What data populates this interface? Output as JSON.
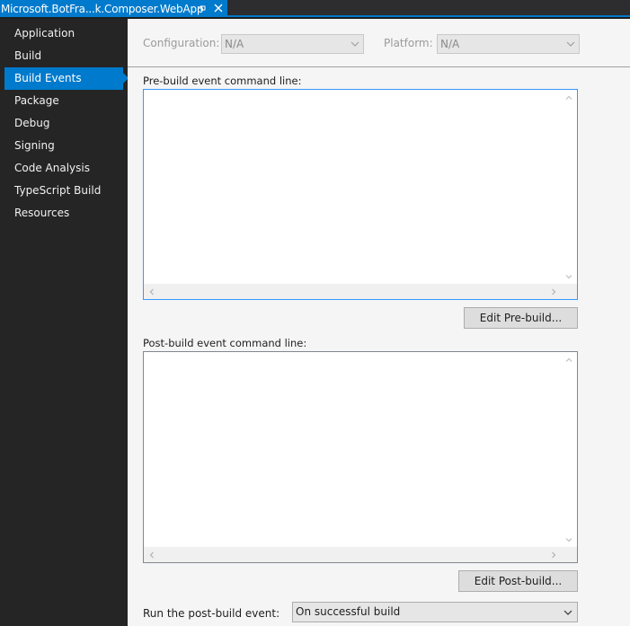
{
  "tab": {
    "title": "Microsoft.BotFra...k.Composer.WebApp",
    "pin_icon": "pin-icon",
    "close_icon": "close-icon"
  },
  "sidebar": {
    "items": [
      {
        "label": "Application",
        "selected": false
      },
      {
        "label": "Build",
        "selected": false
      },
      {
        "label": "Build Events",
        "selected": true
      },
      {
        "label": "Package",
        "selected": false
      },
      {
        "label": "Debug",
        "selected": false
      },
      {
        "label": "Signing",
        "selected": false
      },
      {
        "label": "Code Analysis",
        "selected": false
      },
      {
        "label": "TypeScript Build",
        "selected": false
      },
      {
        "label": "Resources",
        "selected": false
      }
    ]
  },
  "config": {
    "configuration_label": "Configuration:",
    "configuration_value": "N/A",
    "platform_label": "Platform:",
    "platform_value": "N/A"
  },
  "prebuild": {
    "label": "Pre-build event command line:",
    "value": "",
    "edit_button": "Edit Pre-build..."
  },
  "postbuild": {
    "label": "Post-build event command line:",
    "value": "",
    "edit_button": "Edit Post-build..."
  },
  "run_post_build": {
    "label": "Run the post-build event:",
    "value": "On successful build"
  },
  "colors": {
    "accent": "#007acc",
    "sidebar_bg": "#252526",
    "content_bg": "#f5f5f5"
  }
}
